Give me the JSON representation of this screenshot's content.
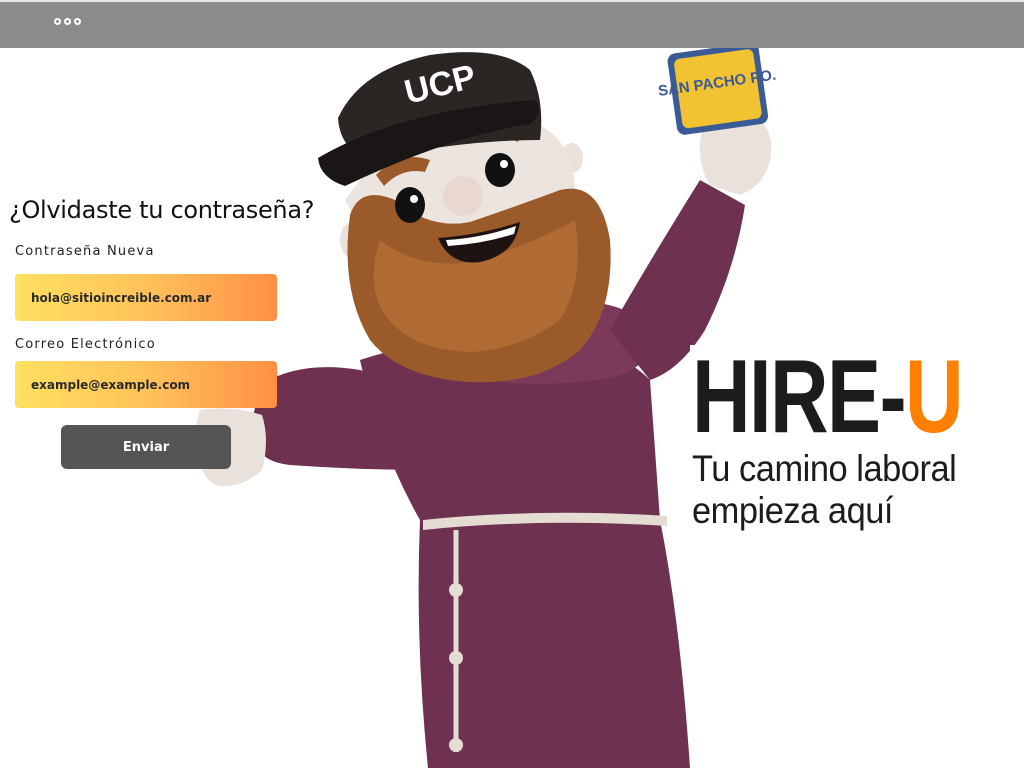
{
  "topbar": {
    "menu_icon": "circles-menu-icon"
  },
  "form": {
    "title": "¿Olvidaste tu contraseña?",
    "password_label": "Contraseña Nueva",
    "password_placeholder": "hola@sitioincreible.com.ar",
    "email_label": "Correo Electrónico",
    "email_placeholder": "example@example.com",
    "submit_label": "Enviar"
  },
  "mascot": {
    "cap_text": "UCP",
    "card_text": "SAN PACHO PO."
  },
  "brand": {
    "logo_main": "HIRE-",
    "logo_accent": "U",
    "tagline": "Tu camino laboral empieza aquí"
  },
  "colors": {
    "topbar": "#8c8c8c",
    "accent": "#ff7f00",
    "input_gradient_start": "#ffe060",
    "input_gradient_end": "#ff8f45",
    "button": "#555555",
    "robe": "#6e3150"
  }
}
